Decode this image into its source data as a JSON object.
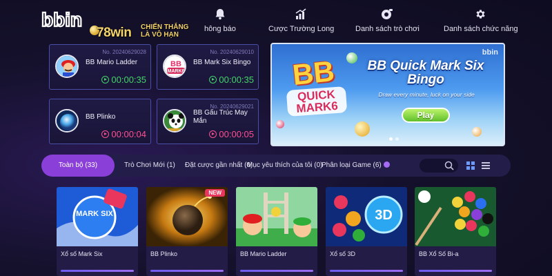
{
  "header": {
    "logo_text": "bbin",
    "watermark": {
      "brand": "78win",
      "slogan_line1": "CHIẾN THẮNG",
      "slogan_line2": "LÀ VÔ HẠN"
    },
    "nav": [
      {
        "label": "hông báo",
        "icon": "bell-icon"
      },
      {
        "label": "Cược Trường Long",
        "icon": "bar-chart-icon"
      },
      {
        "label": "Danh sách trò chơi",
        "icon": "game-list-icon"
      },
      {
        "label": "Danh sách chức năng",
        "icon": "gear-icon"
      }
    ]
  },
  "featured_games": [
    {
      "number": "No. 20240629028",
      "name": "BB Mario Ladder",
      "timer": "00:00:35",
      "timer_color": "#43d46a",
      "avatar": "mario-avatar"
    },
    {
      "number": "No. 20240629010",
      "name": "BB Mark Six Bingo",
      "timer": "00:00:35",
      "timer_color": "#43d46a",
      "avatar": "bingo-avatar"
    },
    {
      "number": "",
      "name": "BB Plinko",
      "timer": "00:00:04",
      "timer_color": "#ff4f92",
      "avatar": "plinko-avatar"
    },
    {
      "number": "No. 20240629021",
      "name": "BB Gấu Trúc May Mắn",
      "timer": "00:00:05",
      "timer_color": "#ff4f92",
      "avatar": "panda-avatar"
    }
  ],
  "banner": {
    "logo_bb": "BB",
    "logo_quick": "QUICK MARK6",
    "title": "BB Quick Mark Six Bingo",
    "tagline": "Draw every minute, luck on your side",
    "play_label": "Play",
    "brand": "bbin",
    "slides": 2,
    "active_slide": 1
  },
  "tabs": [
    {
      "label": "Toàn bộ (33)",
      "active": true
    },
    {
      "label": "Trò Chơi Mới (1)",
      "active": false
    },
    {
      "label": "Đặt cược gần nhất (0)",
      "active": false
    },
    {
      "label": "Mục yêu thích của tôi (0)",
      "active": false
    },
    {
      "label": "Phân loại Game (6)",
      "active": false
    }
  ],
  "search": {
    "placeholder": ""
  },
  "view_modes": [
    "grid-view-icon",
    "list-view-icon"
  ],
  "games": [
    {
      "name": "Xổ số Mark Six",
      "new": false,
      "thumb_text": "MARK SIX"
    },
    {
      "name": "BB Plinko",
      "new": true,
      "badge": "NEW"
    },
    {
      "name": "BB Mario Ladder",
      "new": false
    },
    {
      "name": "Xổ số 3D",
      "new": false,
      "thumb_text": "3D"
    },
    {
      "name": "BB Xổ Số Bi-a",
      "new": false
    }
  ],
  "colors": {
    "accent": "#8a3fd8",
    "timer_green": "#43d46a",
    "timer_pink": "#ff4f92",
    "card_border": "#4a4fa8",
    "background": "#15112c"
  }
}
